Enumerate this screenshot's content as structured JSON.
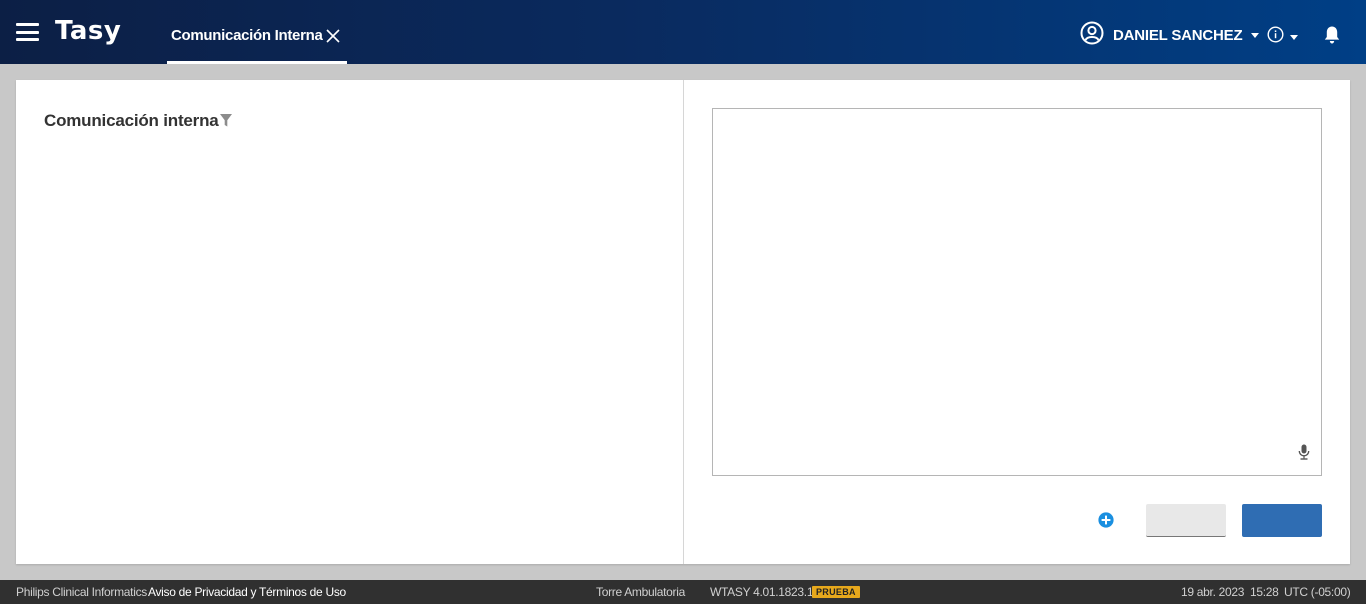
{
  "app": {
    "logo": "Tasy"
  },
  "tabs": [
    {
      "label": "Comunicación Interna"
    }
  ],
  "user": {
    "name": "DANIEL SANCHEZ"
  },
  "icons": {
    "menu": "hamburger-menu-icon",
    "close": "close-icon",
    "user": "user-circle-icon",
    "info": "info-icon",
    "notifications": "bell-icon",
    "filter": "filter-icon",
    "mic": "microphone-icon",
    "add": "plus-circle-icon"
  },
  "left_panel": {
    "title": "Comunicación interna"
  },
  "editor": {
    "value": ""
  },
  "buttons": {
    "secondary_label": "",
    "primary_label": ""
  },
  "footer": {
    "company": "Philips Clinical Informatics",
    "privacy_link": "Aviso de Privacidad y Términos de Uso",
    "location": "Torre Ambulatoria",
    "version": "WTASY 4.01.1823.14",
    "badge": "PRUEBA",
    "date": "19 abr. 2023",
    "time": "15:28",
    "timezone": "UTC (-05:00)"
  },
  "colors": {
    "topbar_start": "#0c1f45",
    "topbar_end": "#003f86",
    "primary_button": "#2f6db3",
    "badge": "#e7a81c",
    "add_icon": "#1a8fe0"
  }
}
